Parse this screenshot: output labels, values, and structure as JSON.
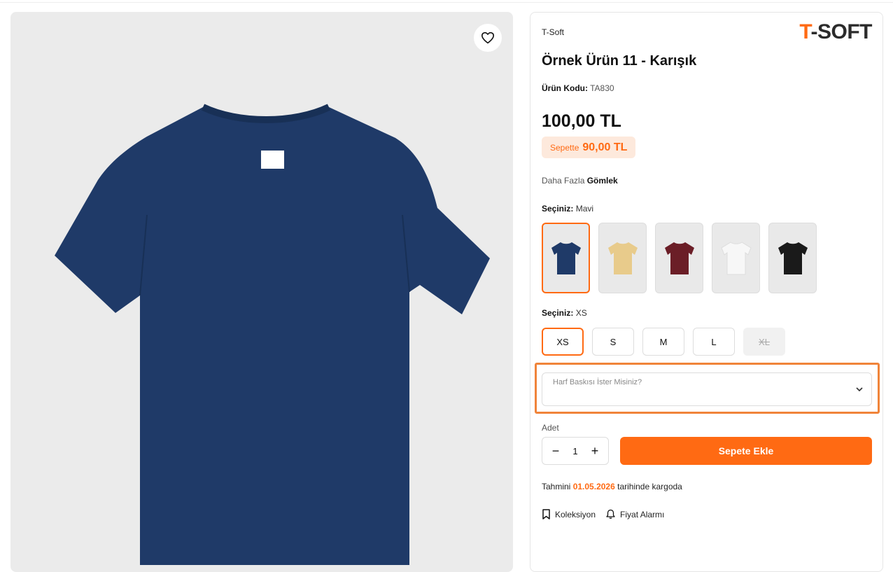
{
  "product": {
    "brand": "T-Soft",
    "logo_accent": "T",
    "logo_rest": "-SOFT",
    "title": "Örnek Ürün 11 - Karışık",
    "code_label": "Ürün Kodu:",
    "code_value": "TA830",
    "price": "100,00 TL",
    "cart_price_label": "Sepette",
    "cart_price_value": "90,00 TL",
    "more_prefix": "Daha Fazla",
    "more_category": "Gömlek"
  },
  "color_select": {
    "label": "Seçiniz:",
    "value": "Mavi",
    "options": [
      {
        "name": "Mavi",
        "color": "#1f3a68",
        "active": true
      },
      {
        "name": "Sarı",
        "color": "#e8cb8b",
        "active": false
      },
      {
        "name": "Bordo",
        "color": "#6b1e27",
        "active": false
      },
      {
        "name": "Beyaz",
        "color": "#f4f4f4",
        "active": false
      },
      {
        "name": "Siyah",
        "color": "#1a1a1a",
        "active": false
      }
    ]
  },
  "size_select": {
    "label": "Seçiniz:",
    "value": "XS",
    "options": [
      "XS",
      "S",
      "M",
      "L",
      "XL"
    ]
  },
  "print_option": {
    "placeholder": "Harf Baskısı İster Misiniz?"
  },
  "quantity": {
    "label": "Adet",
    "minus": "−",
    "value": "1",
    "plus": "+"
  },
  "add_to_cart": "Sepete Ekle",
  "shipping": {
    "prefix": "Tahmini",
    "date": "01.05.2026",
    "suffix": "tarihinde kargoda"
  },
  "links": {
    "collection": "Koleksiyon",
    "price_alarm": "Fiyat Alarmı"
  },
  "colors": {
    "accent": "#ff6a13",
    "shirt": "#1f3a68"
  }
}
